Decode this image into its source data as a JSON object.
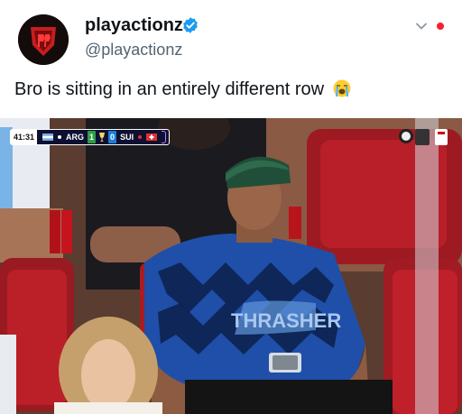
{
  "post": {
    "display_name": "playactionz",
    "handle": "@playactionz",
    "verified": true,
    "text": "Bro is sitting in an entirely different row",
    "emoji": "loudly-crying-face"
  },
  "header_icons": {
    "menu": "chevron-down-icon",
    "notification": "red-dot"
  },
  "media": {
    "type": "video-frame",
    "scorebug": {
      "clock": "41:31",
      "home_team": "ARG",
      "home_score": "1",
      "away_score": "0",
      "away_team": "SUI"
    },
    "jersey_text": "THRASHER"
  },
  "colors": {
    "verified_blue": "#1d9bf0",
    "handle_gray": "#536471",
    "text_dark": "#0f1419",
    "notification_red": "#f4212e"
  }
}
